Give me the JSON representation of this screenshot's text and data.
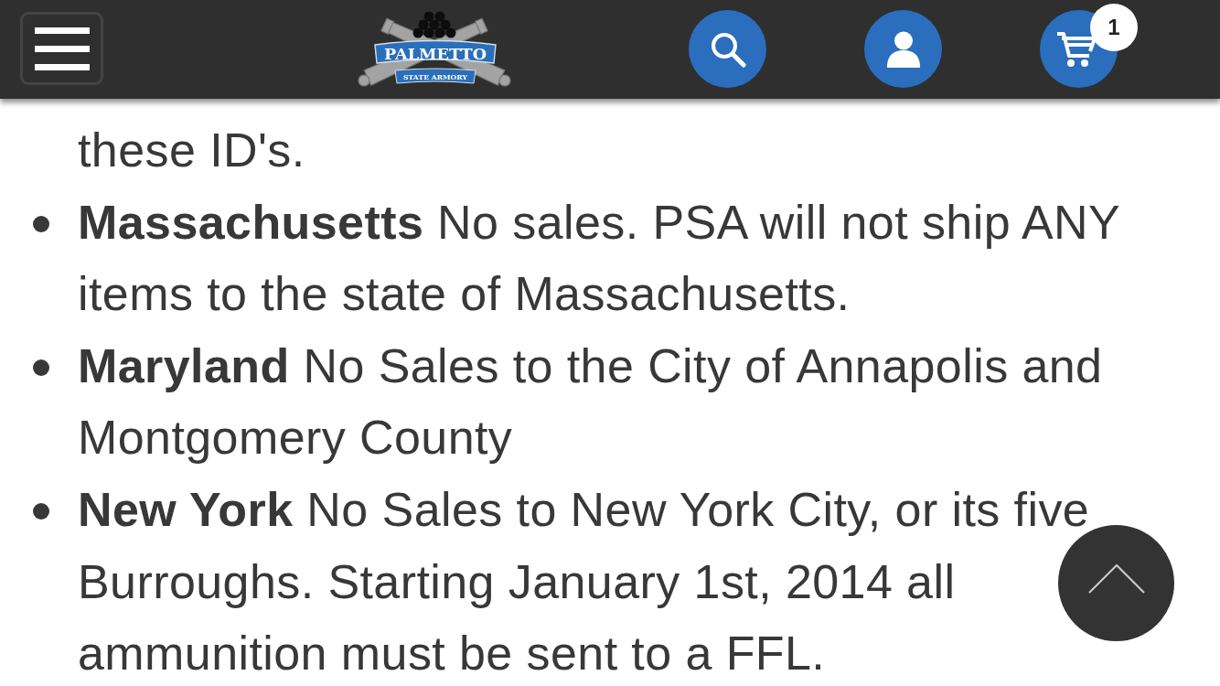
{
  "header": {
    "logo": {
      "title": "PALMETTO",
      "subtitle": "STATE ARMORY"
    },
    "cart_count": "1"
  },
  "content": {
    "lead_text": "these ID's.",
    "items": [
      {
        "text": "**Massachusetts** No sales. PSA will not ship ANY items to the state of Massachusetts."
      },
      {
        "text": "**Maryland** No Sales to the City of Annapolis and Montgomery County"
      },
      {
        "text": "**New York** No Sales to New York City, or its five Burroughs. Starting January 1st, 2014 all ammunition must be sent to a FFL."
      }
    ]
  }
}
